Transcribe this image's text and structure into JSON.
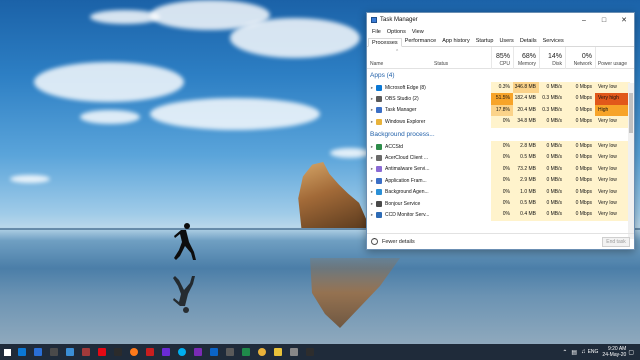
{
  "window": {
    "title": "Task Manager",
    "menu": [
      "File",
      "Options",
      "View"
    ],
    "tabs": [
      "Processes",
      "Performance",
      "App history",
      "Startup",
      "Users",
      "Details",
      "Services"
    ],
    "active_tab": "Processes"
  },
  "columns": {
    "name": "Name",
    "status": "Status",
    "cpu": {
      "pct": "85%",
      "label": "CPU"
    },
    "memory": {
      "pct": "68%",
      "label": "Memory"
    },
    "disk": {
      "pct": "14%",
      "label": "Disk"
    },
    "network": {
      "pct": "0%",
      "label": "Network"
    },
    "power": {
      "label": "Power usage"
    }
  },
  "groups": {
    "apps": "Apps (4)",
    "background": "Background process..."
  },
  "apps": [
    {
      "name": "Microsoft Edge (8)",
      "cpu": "0.3%",
      "mem": "346.8 MB",
      "disk": "0 MB/s",
      "net": "0 Mbps",
      "power": "Very low"
    },
    {
      "name": "OBS Studio (2)",
      "cpu": "51.5%",
      "mem": "182.4 MB",
      "disk": "0.3 MB/s",
      "net": "0 Mbps",
      "power": "Very high"
    },
    {
      "name": "Task Manager",
      "cpu": "17.8%",
      "mem": "20.4 MB",
      "disk": "0.3 MB/s",
      "net": "0 Mbps",
      "power": "High"
    },
    {
      "name": "Windows Explorer",
      "cpu": "0%",
      "mem": "34.8 MB",
      "disk": "0 MB/s",
      "net": "0 Mbps",
      "power": "Very low"
    }
  ],
  "background": [
    {
      "name": "ACCStd",
      "cpu": "0%",
      "mem": "2.8 MB",
      "disk": "0 MB/s",
      "net": "0 Mbps",
      "power": "Very low"
    },
    {
      "name": "AcerCloud Client ...",
      "cpu": "0%",
      "mem": "0.5 MB",
      "disk": "0 MB/s",
      "net": "0 Mbps",
      "power": "Very low"
    },
    {
      "name": "Antimalware Servi...",
      "cpu": "0%",
      "mem": "73.2 MB",
      "disk": "0 MB/s",
      "net": "0 Mbps",
      "power": "Very low"
    },
    {
      "name": "Application Fram...",
      "cpu": "0%",
      "mem": "2.9 MB",
      "disk": "0 MB/s",
      "net": "0 Mbps",
      "power": "Very low"
    },
    {
      "name": "Background Agen...",
      "cpu": "0%",
      "mem": "1.0 MB",
      "disk": "0 MB/s",
      "net": "0 Mbps",
      "power": "Very low"
    },
    {
      "name": "Bonjour Service",
      "cpu": "0%",
      "mem": "0.5 MB",
      "disk": "0 MB/s",
      "net": "0 Mbps",
      "power": "Very low"
    },
    {
      "name": "CCD Monitor Serv...",
      "cpu": "0%",
      "mem": "0.4 MB",
      "disk": "0 MB/s",
      "net": "0 Mbps",
      "power": "Very low"
    }
  ],
  "footer": {
    "fewer_details": "Fewer details",
    "end_task": "End task"
  },
  "taskbar": {
    "icons": [
      "windows-start-icon",
      "edge-icon",
      "mail-icon",
      "store-icon",
      "photos-icon",
      "access-icon",
      "netflix-icon",
      "tablet-icon",
      "firefox-icon",
      "adobe-icon",
      "yahoo-icon",
      "skype-icon",
      "onenote-icon",
      "outlook-icon",
      "calculator-icon",
      "excel-icon",
      "chrome-icon",
      "file-explorer-icon",
      "settings-icon",
      "game-icon"
    ],
    "tray": {
      "lang": "ENG",
      "time": "9:20 AM",
      "date": "24-May-20"
    }
  },
  "colors": {
    "cpu_high": "#f7a429",
    "cpu_mid": "#fbd38a",
    "cell_light": "#fff3cc",
    "power_very_high": "#e1581a",
    "power_high": "#f7a429"
  }
}
